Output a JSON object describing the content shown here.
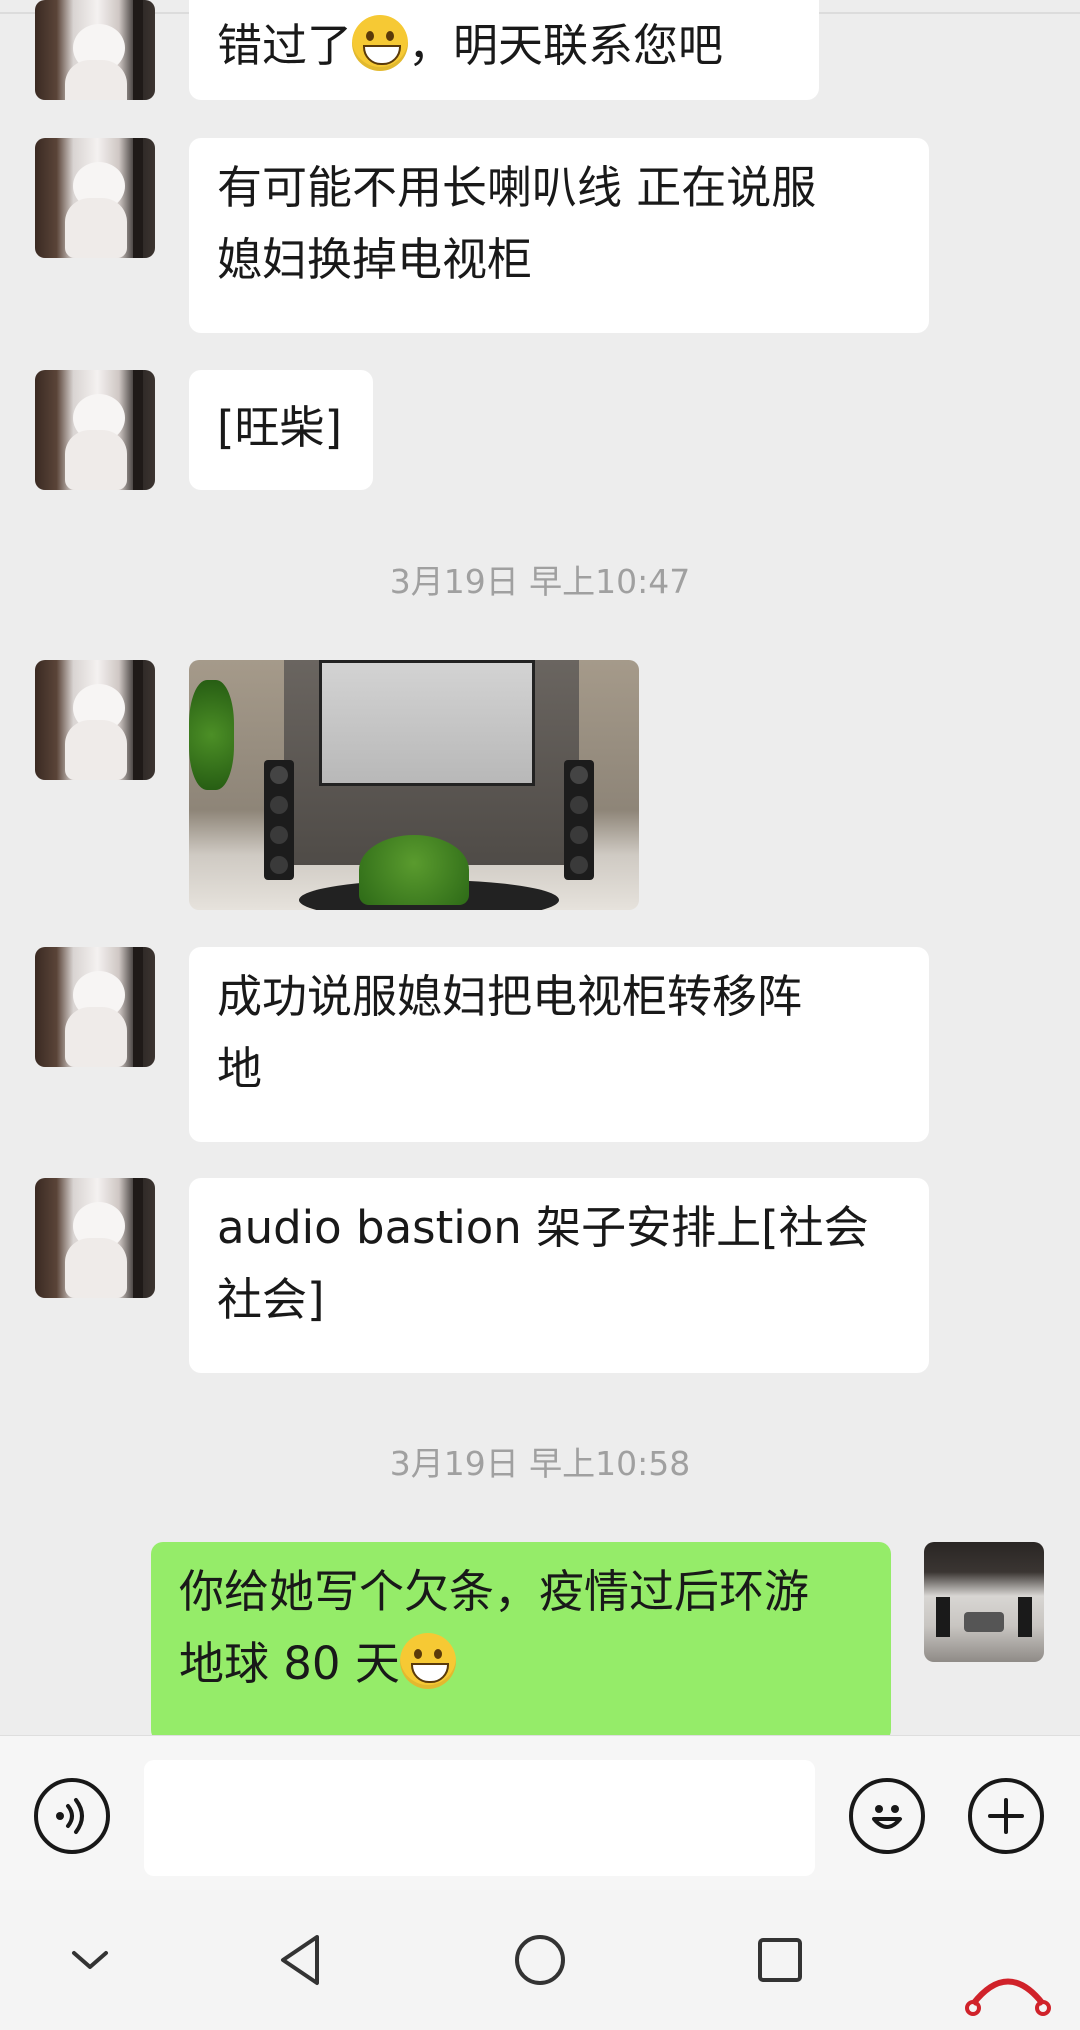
{
  "messages": [
    {
      "sender": "them",
      "text": "错过了",
      "emoji": "grin",
      "text_after": "，明天联系您吧"
    },
    {
      "sender": "them",
      "lines": [
        "有可能不用长喇叭线 正在说服",
        "媳妇换掉电视柜"
      ]
    },
    {
      "sender": "them",
      "text": "[旺柴]"
    },
    {
      "type": "timestamp",
      "text": "3月19日 早上10:47"
    },
    {
      "sender": "them",
      "type": "image",
      "image": "living-room-speakers-photo"
    },
    {
      "sender": "them",
      "lines": [
        "成功说服媳妇把电视柜转移阵",
        "地"
      ]
    },
    {
      "sender": "them",
      "lines": [
        "audio bastion 架子安排上[社会",
        "社会]"
      ]
    },
    {
      "type": "timestamp",
      "text": "3月19日 早上10:58"
    },
    {
      "sender": "me",
      "lines": [
        "你给她写个欠条，疫情过后环游",
        "地球 80 天"
      ],
      "emoji": "grin"
    }
  ],
  "input": {
    "value": "",
    "placeholder": ""
  },
  "icons": {
    "voice": "voice-icon",
    "emoji": "smiley-icon",
    "more": "plus-icon",
    "nav_down": "chevron-down-icon",
    "nav_back": "back-triangle-icon",
    "nav_home": "home-circle-icon",
    "nav_recent": "recent-square-icon"
  },
  "colors": {
    "chat_bg": "#ededed",
    "bubble_them": "#ffffff",
    "bubble_me": "#95ec69",
    "timestamp": "#a0a0a0"
  }
}
